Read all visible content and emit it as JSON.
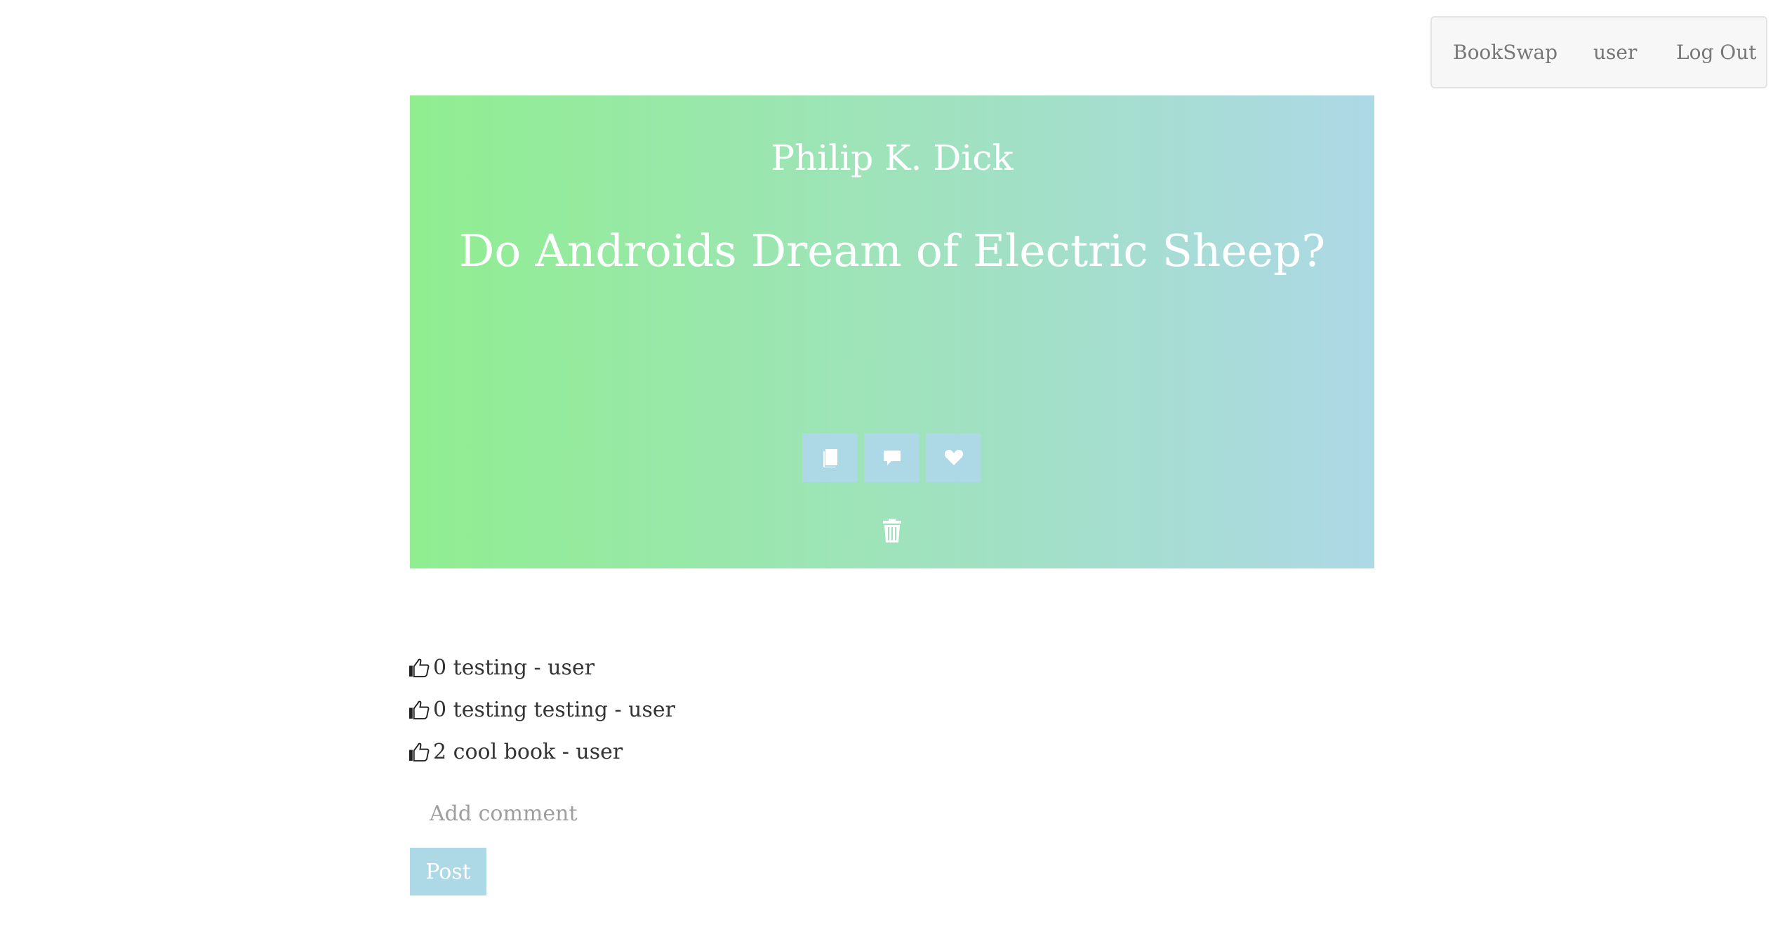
{
  "nav": {
    "brand": "BookSwap",
    "user": "user",
    "logout": "Log Out"
  },
  "book": {
    "author": "Philip K. Dick",
    "title": "Do Androids Dream of Electric Sheep?",
    "actions": [
      {
        "icon": "book-icon"
      },
      {
        "icon": "comment-icon"
      },
      {
        "icon": "heart-icon"
      }
    ],
    "delete_icon": "trash-icon"
  },
  "comments": [
    {
      "likes": "0",
      "text": "testing - user"
    },
    {
      "likes": "0",
      "text": "testing testing - user"
    },
    {
      "likes": "2",
      "text": "cool book - user"
    }
  ],
  "comment_form": {
    "placeholder": "Add comment",
    "post_label": "Post"
  },
  "colors": {
    "gradient_start": "#90ee90",
    "gradient_end": "#add8e6",
    "button": "#add8e6"
  }
}
